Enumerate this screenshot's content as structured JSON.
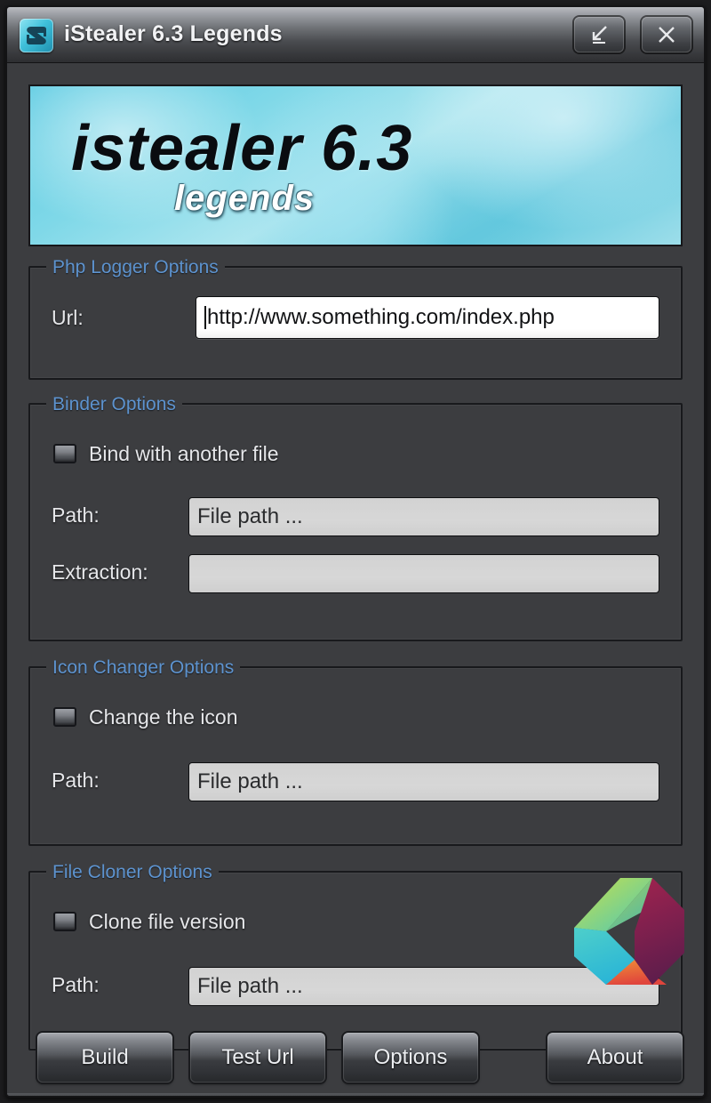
{
  "window": {
    "title": "iStealer 6.3 Legends",
    "icon": "app-logo-icon",
    "minimize_label": "minimize-icon",
    "close_label": "close-icon"
  },
  "banner": {
    "wordmark": "istealer 6.3",
    "subword": "legends"
  },
  "groups": {
    "php_logger": {
      "title": "Php Logger Options",
      "url_label": "Url:",
      "url_value": "http://www.something.com/index.php"
    },
    "binder": {
      "title": "Binder Options",
      "checkbox_label": "Bind with another file",
      "checkbox_checked": false,
      "path_label": "Path:",
      "path_value": "File path ...",
      "extraction_label": "Extraction:",
      "extraction_value": ""
    },
    "icon_changer": {
      "title": "Icon Changer Options",
      "checkbox_label": "Change the icon",
      "checkbox_checked": false,
      "path_label": "Path:",
      "path_value": "File path ..."
    },
    "file_cloner": {
      "title": "File Cloner Options",
      "checkbox_label": "Clone file version",
      "checkbox_checked": false,
      "path_label": "Path:",
      "path_value": "File path ..."
    }
  },
  "buttons": {
    "build": "Build",
    "test_url": "Test Url",
    "options": "Options",
    "about": "About"
  },
  "watermark": {
    "name": "hexagon-logo-watermark",
    "colors": {
      "lime": "#b9d94a",
      "green": "#5fc8a6",
      "cyan": "#35c0d8",
      "orange": "#ef7a3a",
      "red": "#e0453c",
      "magenta": "#9e2352",
      "purple": "#6a1f4e"
    }
  },
  "colors": {
    "window_bg": "#3c3d40",
    "group_title": "#5d93cf",
    "label_text": "#e6e7ea",
    "banner_cyan": "#5ccbe2",
    "input_active_bg": "#ffffff",
    "input_disabled_bg": "#d4d4d4"
  }
}
